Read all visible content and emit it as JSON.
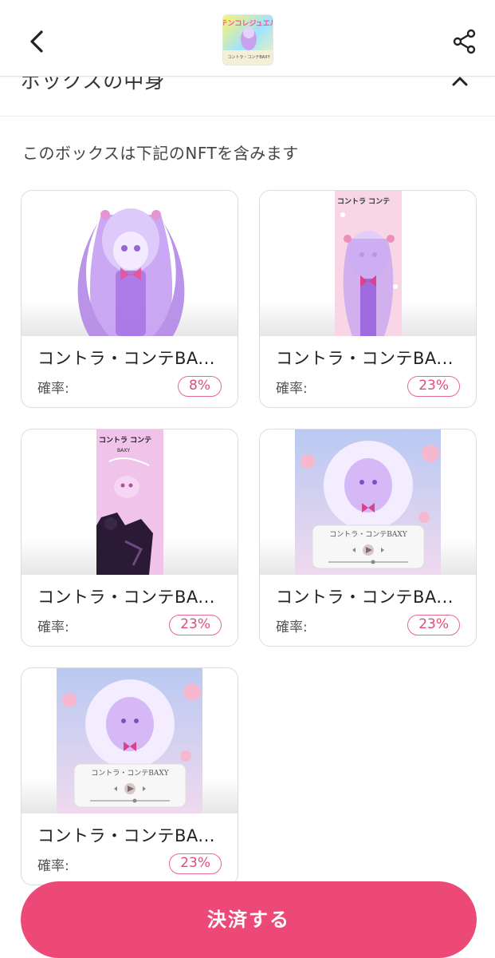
{
  "header": {
    "back_icon": "chevron-left-icon",
    "share_icon": "share-icon",
    "thumbnail_title": "テンコレジュエル",
    "thumbnail_subtitle": "コントラ・コンテBAXY"
  },
  "section": {
    "title": "ボックスの中身",
    "toggle_icon": "chevron-up-icon"
  },
  "description": "このボックスは下記のNFTを含みます",
  "items": [
    {
      "name": "コントラ・コンテBA...",
      "prob_label": "確率:",
      "probability": "8%",
      "art": "character"
    },
    {
      "name": "コントラ・コンテBA...",
      "prob_label": "確率:",
      "probability": "23%",
      "art": "pink-poster"
    },
    {
      "name": "コントラ・コンテBA...",
      "prob_label": "確率:",
      "probability": "23%",
      "art": "dark-poster"
    },
    {
      "name": "コントラ・コンテBA...",
      "prob_label": "確率:",
      "probability": "23%",
      "art": "music-player"
    },
    {
      "name": "コントラ・コンテBA...",
      "prob_label": "確率:",
      "probability": "23%",
      "art": "music-player"
    }
  ],
  "poster_text": "コントラ コンテ",
  "poster_sub": "BAXY",
  "player_title": "コントラ・コンテBAXY",
  "checkout_label": "決済する",
  "colors": {
    "accent": "#ec4977",
    "badge_border": "#e56a8d",
    "badge_text": "#e04c78"
  }
}
